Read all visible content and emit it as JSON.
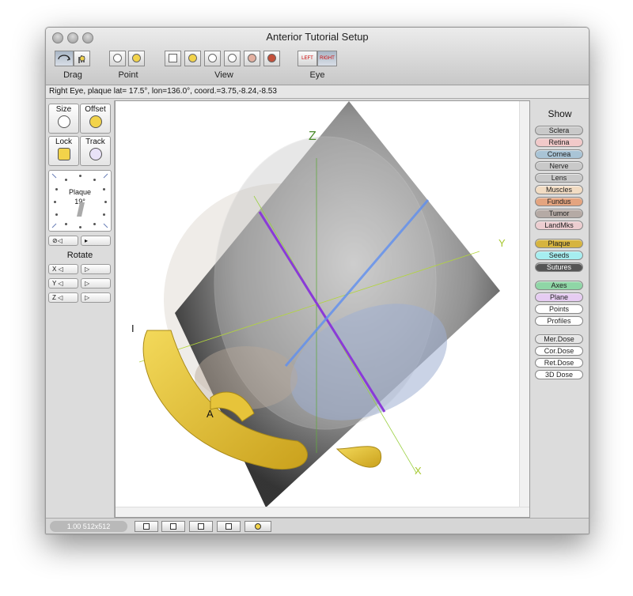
{
  "window": {
    "title": "Anterior Tutorial Setup"
  },
  "toolbar": {
    "groups": [
      {
        "label": "Drag"
      },
      {
        "label": "Point"
      },
      {
        "label": "View"
      },
      {
        "label": "Eye"
      }
    ],
    "eye_left": "LEFT",
    "eye_right": "RIGHT"
  },
  "status": {
    "text": "Right Eye, plaque lat= 17.5°, lon=136.0°, coord.=3.75,-8.24,-8.53"
  },
  "left_panel": {
    "tools": {
      "size": "Size",
      "offset": "Offset",
      "lock": "Lock",
      "track": "Track"
    },
    "clock": {
      "label": "Plaque",
      "angle": "19°"
    },
    "rotate_label": "Rotate",
    "axes": [
      "X",
      "Y",
      "Z"
    ]
  },
  "viewport": {
    "axis_labels": {
      "z": "Z",
      "y": "Y",
      "x": "X"
    },
    "marks": {
      "i": "I",
      "a": "A"
    }
  },
  "right_panel": {
    "title": "Show",
    "items": [
      {
        "label": "Sclera",
        "color": "#c9c9c9"
      },
      {
        "label": "Retina",
        "color": "#f1c9c9"
      },
      {
        "label": "Cornea",
        "color": "#a9c4d6"
      },
      {
        "label": "Nerve",
        "color": "#c9c9c9"
      },
      {
        "label": "Lens",
        "color": "#c9c9c9"
      },
      {
        "label": "Muscles",
        "color": "#f2dcc3"
      },
      {
        "label": "Fundus",
        "color": "#e4a47f"
      },
      {
        "label": "Tumor",
        "color": "#b5aaa5"
      },
      {
        "label": "LandMks",
        "color": "#eccdd0"
      },
      {
        "label": "Plaque",
        "color": "#d6b43f"
      },
      {
        "label": "Seeds",
        "color": "#a6eef0"
      },
      {
        "label": "Sutures",
        "color": "#555555"
      },
      {
        "label": "Axes",
        "color": "#8fd6a6"
      },
      {
        "label": "Plane",
        "color": "#e6ccf2"
      },
      {
        "label": "Points",
        "color": "#ffffff"
      },
      {
        "label": "Profiles",
        "color": "#ffffff"
      },
      {
        "label": "Mer.Dose",
        "color": "#e6e6e6"
      },
      {
        "label": "Cor.Dose",
        "color": "#ffffff"
      },
      {
        "label": "Ret.Dose",
        "color": "#ffffff"
      },
      {
        "label": "3D Dose",
        "color": "#ffffff"
      }
    ]
  },
  "bottom_bar": {
    "zoom_text": "1.00 512x512"
  }
}
